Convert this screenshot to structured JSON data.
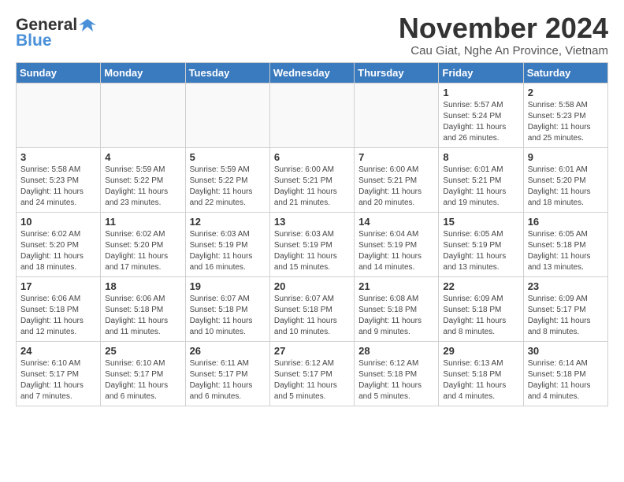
{
  "logo": {
    "general": "General",
    "blue": "Blue",
    "tagline": ""
  },
  "header": {
    "month": "November 2024",
    "location": "Cau Giat, Nghe An Province, Vietnam"
  },
  "weekdays": [
    "Sunday",
    "Monday",
    "Tuesday",
    "Wednesday",
    "Thursday",
    "Friday",
    "Saturday"
  ],
  "weeks": [
    [
      {
        "day": "",
        "info": ""
      },
      {
        "day": "",
        "info": ""
      },
      {
        "day": "",
        "info": ""
      },
      {
        "day": "",
        "info": ""
      },
      {
        "day": "",
        "info": ""
      },
      {
        "day": "1",
        "info": "Sunrise: 5:57 AM\nSunset: 5:24 PM\nDaylight: 11 hours and 26 minutes."
      },
      {
        "day": "2",
        "info": "Sunrise: 5:58 AM\nSunset: 5:23 PM\nDaylight: 11 hours and 25 minutes."
      }
    ],
    [
      {
        "day": "3",
        "info": "Sunrise: 5:58 AM\nSunset: 5:23 PM\nDaylight: 11 hours and 24 minutes."
      },
      {
        "day": "4",
        "info": "Sunrise: 5:59 AM\nSunset: 5:22 PM\nDaylight: 11 hours and 23 minutes."
      },
      {
        "day": "5",
        "info": "Sunrise: 5:59 AM\nSunset: 5:22 PM\nDaylight: 11 hours and 22 minutes."
      },
      {
        "day": "6",
        "info": "Sunrise: 6:00 AM\nSunset: 5:21 PM\nDaylight: 11 hours and 21 minutes."
      },
      {
        "day": "7",
        "info": "Sunrise: 6:00 AM\nSunset: 5:21 PM\nDaylight: 11 hours and 20 minutes."
      },
      {
        "day": "8",
        "info": "Sunrise: 6:01 AM\nSunset: 5:21 PM\nDaylight: 11 hours and 19 minutes."
      },
      {
        "day": "9",
        "info": "Sunrise: 6:01 AM\nSunset: 5:20 PM\nDaylight: 11 hours and 18 minutes."
      }
    ],
    [
      {
        "day": "10",
        "info": "Sunrise: 6:02 AM\nSunset: 5:20 PM\nDaylight: 11 hours and 18 minutes."
      },
      {
        "day": "11",
        "info": "Sunrise: 6:02 AM\nSunset: 5:20 PM\nDaylight: 11 hours and 17 minutes."
      },
      {
        "day": "12",
        "info": "Sunrise: 6:03 AM\nSunset: 5:19 PM\nDaylight: 11 hours and 16 minutes."
      },
      {
        "day": "13",
        "info": "Sunrise: 6:03 AM\nSunset: 5:19 PM\nDaylight: 11 hours and 15 minutes."
      },
      {
        "day": "14",
        "info": "Sunrise: 6:04 AM\nSunset: 5:19 PM\nDaylight: 11 hours and 14 minutes."
      },
      {
        "day": "15",
        "info": "Sunrise: 6:05 AM\nSunset: 5:19 PM\nDaylight: 11 hours and 13 minutes."
      },
      {
        "day": "16",
        "info": "Sunrise: 6:05 AM\nSunset: 5:18 PM\nDaylight: 11 hours and 13 minutes."
      }
    ],
    [
      {
        "day": "17",
        "info": "Sunrise: 6:06 AM\nSunset: 5:18 PM\nDaylight: 11 hours and 12 minutes."
      },
      {
        "day": "18",
        "info": "Sunrise: 6:06 AM\nSunset: 5:18 PM\nDaylight: 11 hours and 11 minutes."
      },
      {
        "day": "19",
        "info": "Sunrise: 6:07 AM\nSunset: 5:18 PM\nDaylight: 11 hours and 10 minutes."
      },
      {
        "day": "20",
        "info": "Sunrise: 6:07 AM\nSunset: 5:18 PM\nDaylight: 11 hours and 10 minutes."
      },
      {
        "day": "21",
        "info": "Sunrise: 6:08 AM\nSunset: 5:18 PM\nDaylight: 11 hours and 9 minutes."
      },
      {
        "day": "22",
        "info": "Sunrise: 6:09 AM\nSunset: 5:18 PM\nDaylight: 11 hours and 8 minutes."
      },
      {
        "day": "23",
        "info": "Sunrise: 6:09 AM\nSunset: 5:17 PM\nDaylight: 11 hours and 8 minutes."
      }
    ],
    [
      {
        "day": "24",
        "info": "Sunrise: 6:10 AM\nSunset: 5:17 PM\nDaylight: 11 hours and 7 minutes."
      },
      {
        "day": "25",
        "info": "Sunrise: 6:10 AM\nSunset: 5:17 PM\nDaylight: 11 hours and 6 minutes."
      },
      {
        "day": "26",
        "info": "Sunrise: 6:11 AM\nSunset: 5:17 PM\nDaylight: 11 hours and 6 minutes."
      },
      {
        "day": "27",
        "info": "Sunrise: 6:12 AM\nSunset: 5:17 PM\nDaylight: 11 hours and 5 minutes."
      },
      {
        "day": "28",
        "info": "Sunrise: 6:12 AM\nSunset: 5:18 PM\nDaylight: 11 hours and 5 minutes."
      },
      {
        "day": "29",
        "info": "Sunrise: 6:13 AM\nSunset: 5:18 PM\nDaylight: 11 hours and 4 minutes."
      },
      {
        "day": "30",
        "info": "Sunrise: 6:14 AM\nSunset: 5:18 PM\nDaylight: 11 hours and 4 minutes."
      }
    ]
  ]
}
